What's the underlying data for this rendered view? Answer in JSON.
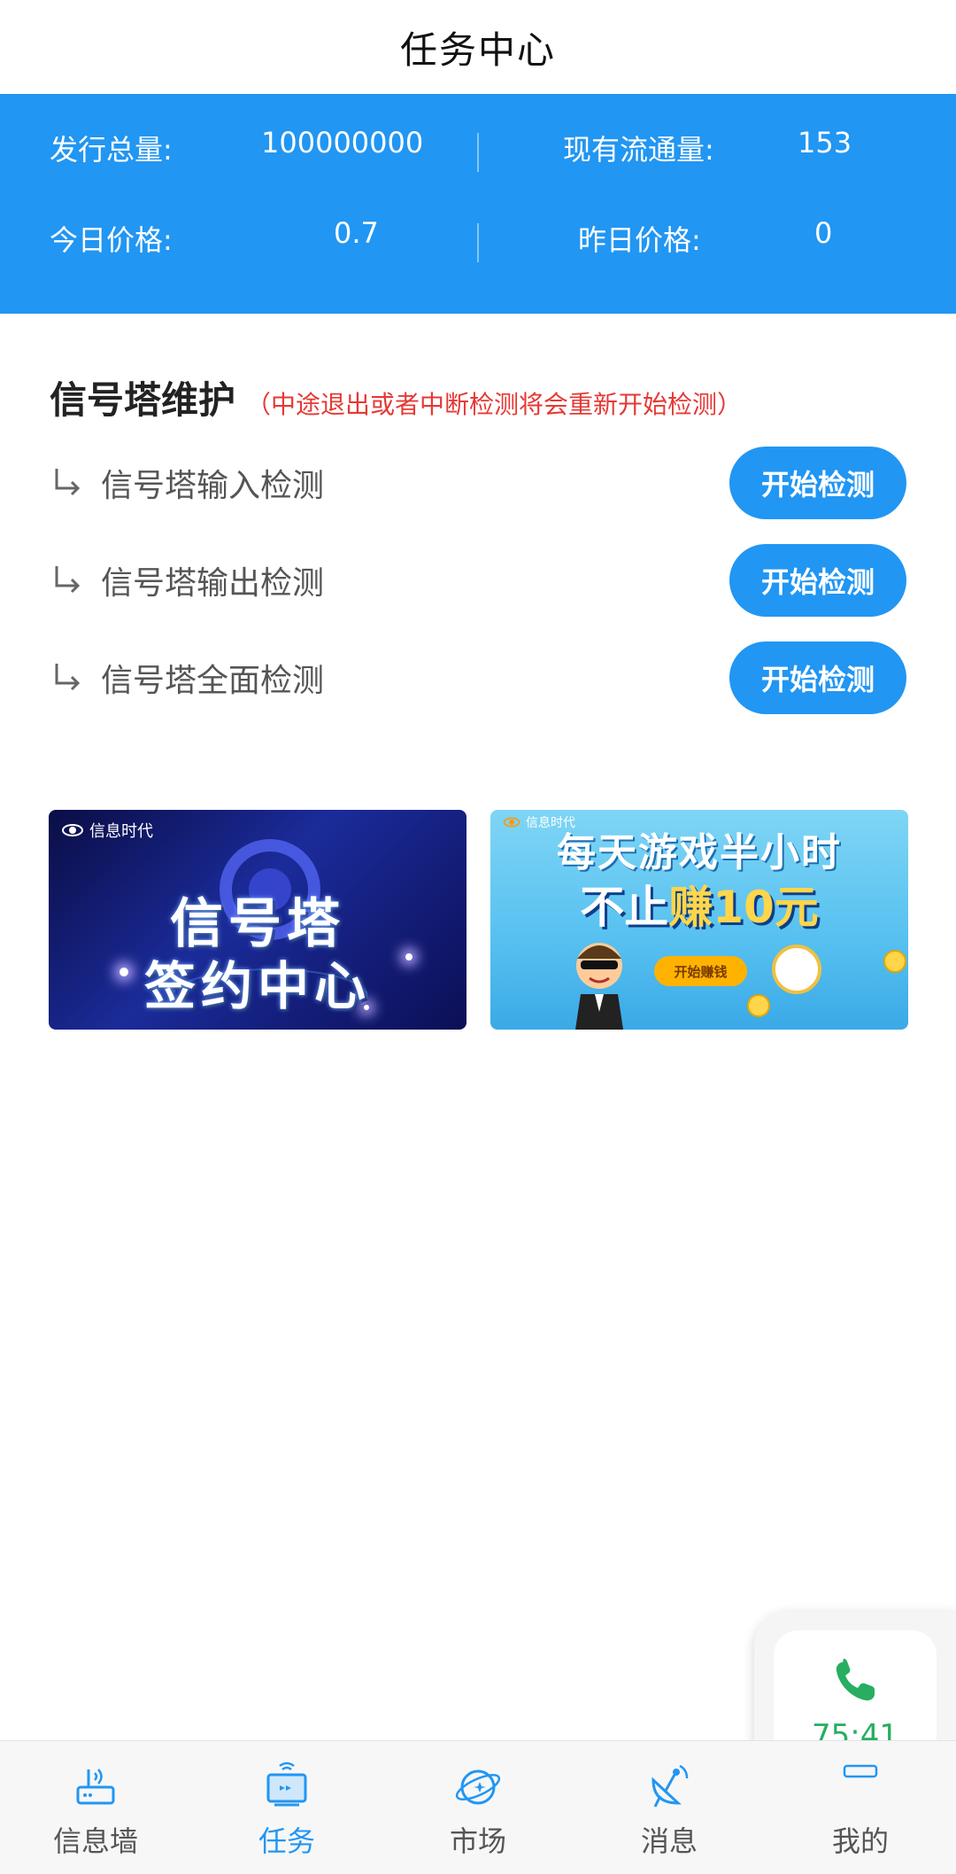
{
  "header": {
    "title": "任务中心"
  },
  "stats": {
    "total_label": "发行总量:",
    "total_value": "100000000",
    "circulation_label": "现有流通量:",
    "circulation_value": "153",
    "today_label": "今日价格:",
    "today_value": "0.7",
    "yesterday_label": "昨日价格:",
    "yesterday_value": "0"
  },
  "section": {
    "title": "信号塔维护",
    "note": "（中途退出或者中断检测将会重新开始检测）"
  },
  "tasks": [
    {
      "label": "信号塔输入检测",
      "button": "开始检测"
    },
    {
      "label": "信号塔输出检测",
      "button": "开始检测"
    },
    {
      "label": "信号塔全面检测",
      "button": "开始检测"
    }
  ],
  "banners": {
    "left": {
      "brand": "信息时代",
      "line1": "信号塔",
      "line2": "签约中心"
    },
    "right": {
      "brand": "信息时代",
      "line1": "每天游戏半小时",
      "line2_a": "不止",
      "line2_b": "赚10元",
      "button": "开始赚钱"
    }
  },
  "nav": {
    "items": [
      {
        "label": "信息墙",
        "icon": "router-icon"
      },
      {
        "label": "任务",
        "icon": "monitor-icon"
      },
      {
        "label": "市场",
        "icon": "planet-icon"
      },
      {
        "label": "消息",
        "icon": "satellite-dish-icon"
      },
      {
        "label": "我的",
        "icon": "profile-icon"
      }
    ],
    "active_index": 1
  },
  "call": {
    "time": "75:41"
  },
  "colors": {
    "primary": "#2196F3",
    "warning": "#E53935",
    "call_green": "#27ae60"
  }
}
